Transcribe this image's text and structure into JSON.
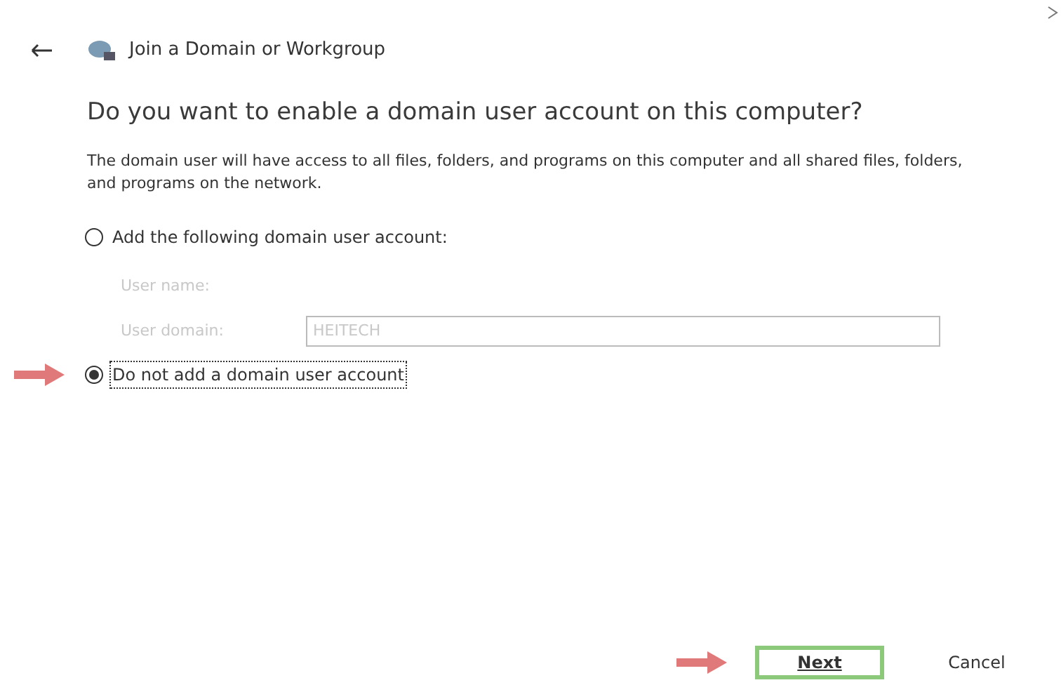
{
  "window": {
    "title": "Join a Domain or Workgroup"
  },
  "heading": "Do you want to enable a domain user account on this computer?",
  "description": "The domain user will have access to all files, folders, and programs on this computer and all shared files, folders, and programs on the network.",
  "options": [
    {
      "label": "Add the following domain user account:",
      "selected": false,
      "focused": false
    },
    {
      "label": "Do not add a domain user account",
      "selected": true,
      "focused": true
    }
  ],
  "fields": [
    {
      "label": "User name:",
      "boxed": false,
      "disabled": true
    },
    {
      "label": "User domain:",
      "value": "HEITECH",
      "boxed": true,
      "disabled": true
    }
  ],
  "buttons": [
    {
      "label": "Next",
      "highlighted": true
    },
    {
      "label": "Cancel",
      "highlighted": false
    }
  ]
}
